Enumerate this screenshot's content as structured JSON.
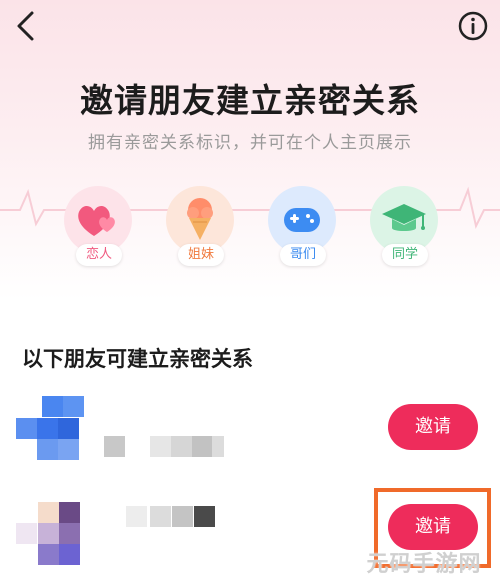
{
  "header": {
    "title": "邀请朋友建立亲密关系",
    "subtitle": "拥有亲密关系标识，并可在个人主页展示"
  },
  "relations": [
    {
      "label": "恋人",
      "icon": "hearts-icon",
      "color": "#f05a80"
    },
    {
      "label": "姐妹",
      "icon": "ice-cream-icon",
      "color": "#f07a3e"
    },
    {
      "label": "哥们",
      "icon": "game-controller-icon",
      "color": "#3a8af0"
    },
    {
      "label": "同学",
      "icon": "graduation-cap-icon",
      "color": "#3fb577"
    }
  ],
  "section": {
    "title": "以下朋友可建立亲密关系"
  },
  "friends": [
    {
      "invite_label": "邀请"
    },
    {
      "invite_label": "邀请"
    }
  ],
  "watermark": "元码手游网",
  "colors": {
    "accent": "#ee2c5b",
    "highlight": "#f06a2a"
  }
}
